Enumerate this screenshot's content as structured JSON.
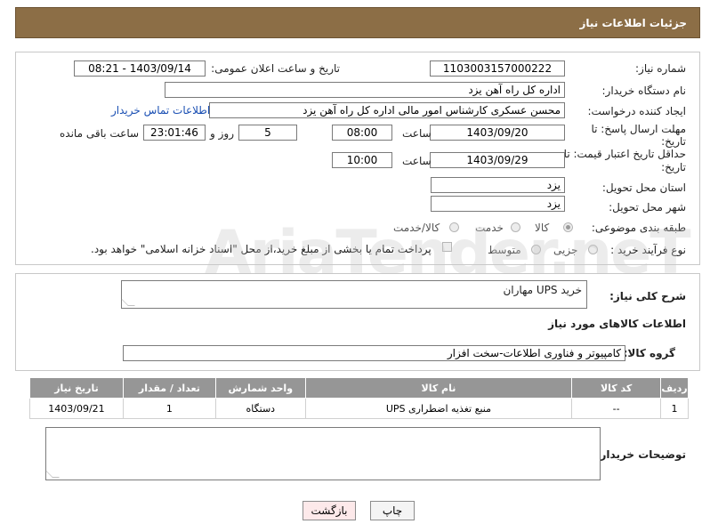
{
  "header": {
    "title": "جزئیات اطلاعات نیاز"
  },
  "form": {
    "need_number_label": "شماره نیاز:",
    "need_number": "1103003157000222",
    "announce_label": "تاریخ و ساعت اعلان عمومی:",
    "announce_value": "1403/09/14 - 08:21",
    "buyer_org_label": "نام دستگاه خریدار:",
    "buyer_org": "اداره کل راه آهن یزد",
    "creator_label": "ایجاد کننده درخواست:",
    "creator": "محسن عسکری کارشناس امور مالی اداره کل راه آهن یزد",
    "contact_link": "اطلاعات تماس خریدار",
    "deadline_label_1": "مهلت ارسال پاسخ: تا",
    "deadline_label_2": "تاریخ:",
    "deadline_date": "1403/09/20",
    "time_label": "ساعت",
    "deadline_time": "08:00",
    "days_value": "5",
    "days_label": "روز و",
    "remaining_time": "23:01:46",
    "remaining_label": "ساعت باقی مانده",
    "validity_label_1": "حداقل تاریخ اعتبار قیمت: تا",
    "validity_label_2": "تاریخ:",
    "validity_date": "1403/09/29",
    "validity_time_label": "ساعت",
    "validity_time": "10:00",
    "province_label": "استان محل تحویل:",
    "province": "یزد",
    "city_label": "شهر محل تحویل:",
    "city": "یزد",
    "category_label": "طبقه بندی موضوعی:",
    "category_options": [
      "کالا",
      "خدمت",
      "کالا/خدمت"
    ],
    "process_label": "نوع فرآیند خرید :",
    "process_options": [
      "جزیی",
      "متوسط"
    ],
    "payment_note": "پرداخت تمام یا بخشی از مبلغ خرید،از محل \"اسناد خزانه اسلامی\" خواهد بود."
  },
  "summary": {
    "label": "شرح کلی نیاز:",
    "value": "خرید UPS مهاران",
    "goods_info_title": "اطلاعات کالاهای مورد نیاز",
    "goods_group_label": "گروه کالا:",
    "goods_group": "کامپیوتر و فناوری اطلاعات-سخت افزار"
  },
  "table": {
    "headers": [
      "ردیف",
      "کد کالا",
      "نام کالا",
      "واحد شمارش",
      "تعداد / مقدار",
      "تاریخ نیاز"
    ],
    "rows": [
      [
        "1",
        "--",
        "منبع تغذیه اضطراری UPS",
        "دستگاه",
        "1",
        "1403/09/21"
      ]
    ]
  },
  "buyer_notes": {
    "label": "توضیحات خریدار:"
  },
  "buttons": {
    "print": "چاپ",
    "back": "بازگشت"
  },
  "watermark": {
    "text": "AriaTender.neT"
  },
  "colors": {
    "header_bg": "#8c6e46",
    "table_header_bg": "#969696",
    "link": "#1a4fb3",
    "back_button_bg": "#fde9ea"
  }
}
